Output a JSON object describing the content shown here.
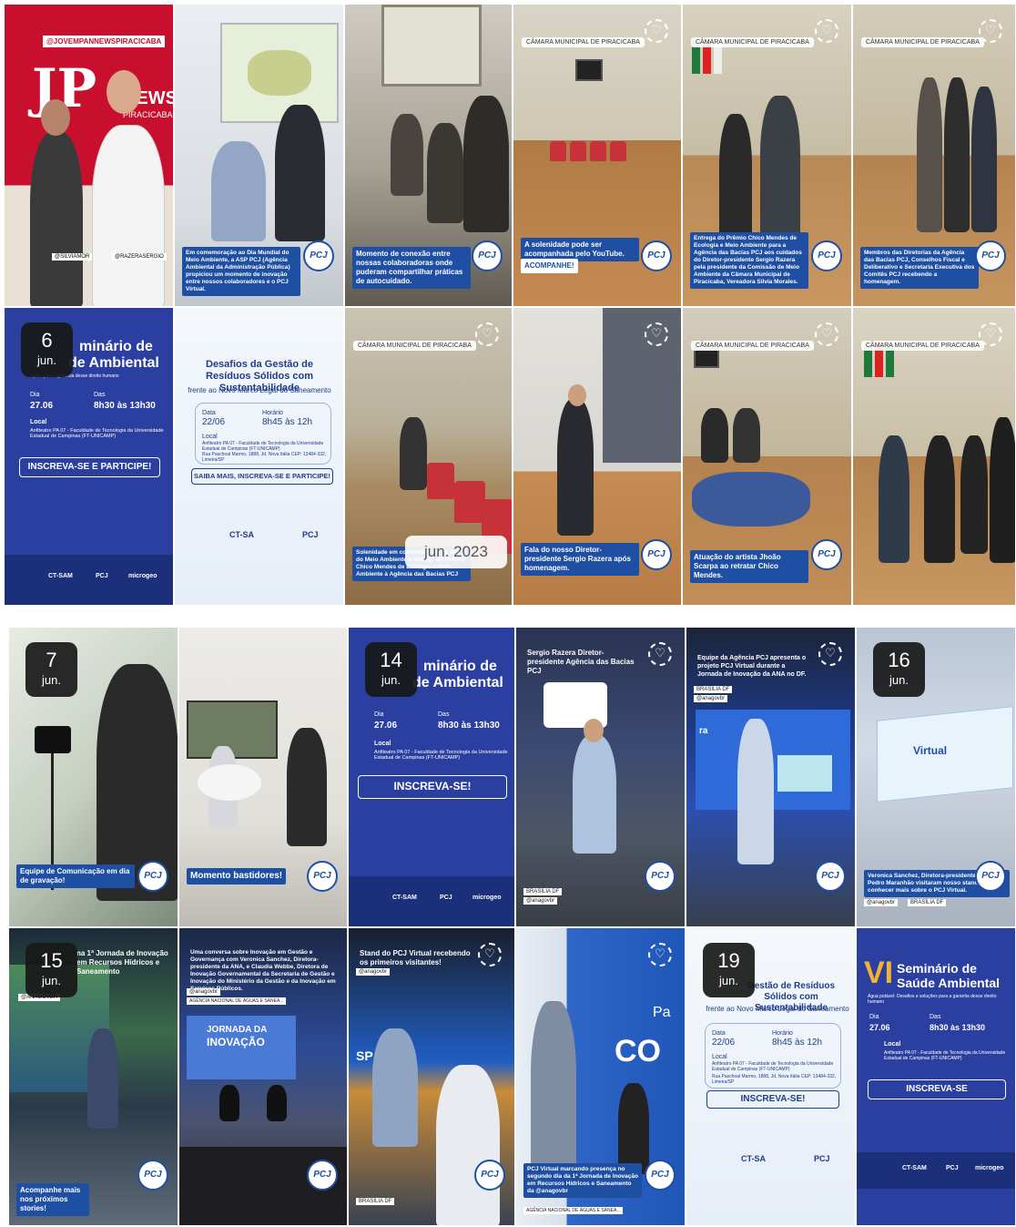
{
  "stories": {
    "t1": {
      "top_tag": "@JOVEMPANNEWSPIRACICABA",
      "brand": "JP",
      "city": "PIRACICABA",
      "tag_left": "@SILVIAMOR",
      "tag_right": "@RAZERASERGIO"
    },
    "t2": {
      "caption": "Em comemoração ao Dia Mundial do Meio Ambiente, a ASP PCJ (Agência Ambiental da Administração Pública) propiciou um momento de inovação entre nossos colaboradores e o PCJ Virtual."
    },
    "t3": {
      "caption": "Momento de conexão entre nossas colaboradoras onde puderam compartilhar práticas de autocuidado."
    },
    "t4": {
      "location": "CÂMARA MUNICIPAL DE PIRACICABA",
      "caption": "A solenidade pode ser acompanhada pelo YouTube.",
      "link": "ACOMPANHE!"
    },
    "t5": {
      "location": "CÂMARA MUNICIPAL DE PIRACICABA",
      "caption": "Entrega do Prêmio Chico Mendes de Ecologia e Meio Ambiente para a Agência das Bacias PCJ aos cuidados do Diretor-presidente Sergio Razera pela presidente da Comissão de Meio Ambiente da Câmara Municipal de Piracicaba, Vereadora Silvia Morales."
    },
    "t6": {
      "location": "CÂMARA MUNICIPAL DE PIRACICABA",
      "caption": "Membros das Diretorias da Agência das Bacias PCJ, Conselhos Fiscal e Deliberativo e Secretaria Executiva dos Comitês PCJ recebendo a homenagem."
    },
    "t7": {
      "date_day": "6",
      "date_month": "jun.",
      "title_a": "minário de",
      "title_b": "de Ambiental",
      "subtitle": "ações para a garantia desse direito humano",
      "dia_label": "Dia",
      "dia": "27.06",
      "horas_label": "Das",
      "horas": "8h30 às 13h30",
      "local_label": "Local",
      "local": "Anfiteatro PA 07 - Faculdade de Tecnologia da Universidade Estadual de Campinas (FT-UNICAMP)",
      "button": "INSCREVA-SE E PARTICIPE!",
      "f1": "CT-SAM",
      "f2": "PCJ",
      "f3": "microgeo"
    },
    "t8": {
      "title": "Desafios da Gestão de Resíduos Sólidos com Sustentabilidade",
      "subtitle": "frente ao Novo Marco Legal do Saneamento",
      "data_label": "Data",
      "data": "22/06",
      "hora_label": "Horário",
      "hora": "8h45 às 12h",
      "local_label": "Local",
      "local": "Anfiteatro PA 07 - Faculdade de Tecnologia da Universidade Estadual de Campinas (FT-UNICAMP)",
      "addr": "Rua Paschoal Marmo, 1888, Jd. Nova Itália CEP: 13484-332, Limeira/SP",
      "button": "SAIBA MAIS, INSCREVA-SE E PARTICIPE!",
      "f1": "CT-SA",
      "f2": "PCJ"
    },
    "t9": {
      "location": "CÂMARA MUNICIPAL DE PIRACICABA",
      "caption": "Solenidade em comemoração ao Dia do Meio Ambiente e entrega do Prêmio Chico Mendes de Ecologia e Meio Ambiente à Agência das Bacias PCJ",
      "overlay": "jun. 2023"
    },
    "t10": {
      "caption": "Fala do nosso Diretor-presidente Sergio Razera após homenagem."
    },
    "t11": {
      "location": "CÂMARA MUNICIPAL DE PIRACICABA",
      "caption": "Atuação do artista Jhoão Scarpa ao retratar Chico Mendes."
    },
    "t12": {
      "location": "CÂMARA MUNICIPAL DE PIRACICABA"
    },
    "t13": {
      "date_day": "7",
      "date_month": "jun.",
      "caption": "Equipe de Comunicação em dia de gravação!"
    },
    "t14": {
      "caption": "Momento bastidores!"
    },
    "t15": {
      "date_day": "14",
      "date_month": "jun.",
      "title_a": "minário de",
      "title_b": "de Ambiental",
      "dia_label": "Dia",
      "dia": "27.06",
      "horas_label": "Das",
      "horas": "8h30 às 13h30",
      "local_label": "Local",
      "local": "Anfiteatro PA 07 - Faculdade de Tecnologia da Universidade Estadual de Campinas (FT-UNICAMP)",
      "button": "INSCREVA-SE!",
      "f1": "CT-SAM",
      "f2": "PCJ",
      "f3": "microgeo"
    },
    "t16": {
      "caption": "Sergio Razera Diretor-presidente Agência das Bacias PCJ",
      "tag1": "BRASÍLIA DF",
      "tag2": "@anagovbr"
    },
    "t17": {
      "caption": "Equipe da Agência PCJ apresenta o projeto PCJ Virtual durante a Jornada de Inovação da ANA no DF.",
      "tag1": "BRASÍLIA DF",
      "tag2": "@anagovbr",
      "screen_text": "ra"
    },
    "t18": {
      "date_day": "16",
      "date_month": "jun.",
      "box_label": "Virtual",
      "caption": "Veronica Sanchez, Diretora-presidente da ANA e Pedro Maranhão visitaram nosso stand para conhecer mais sobre o PCJ Virtual.",
      "tag1": "@anagovbr",
      "tag2": "BRASÍLIA DF"
    },
    "t19": {
      "date_day": "15",
      "date_month": "jun.",
      "caption_top": "na 1ª Jornada de Inovação em Recursos Hídricos e Saneamento",
      "tag": "@ANAGOVBR",
      "caption": "Acompanhe mais nos próximos stories!"
    },
    "t20": {
      "caption": "Uma conversa sobre Inovação em Gestão e Governança com Veronica Sanchez, Diretora-presidente da ANA, e Claudia Webbe, Diretora de Inovação Governamental da Secretaria de Gestão e Inovação do Ministério da Gestão e da Inovação em Serviços Públicos.",
      "tag": "@anagovbr",
      "tag2": "AGÊNCIA NACIONAL DE ÁGUAS E SANEA...",
      "screen_a": "JORNADA DA",
      "screen_b": "INOVAÇÃO"
    },
    "t21": {
      "caption": "Stand do PCJ Virtual recebendo os primeiros visitantes!",
      "tag": "@anagovbr",
      "tag2": "BRASÍLIA DF",
      "wall": "SP"
    },
    "t22": {
      "wall_a": "Pa",
      "wall_b": "CO",
      "caption": "PCJ Virtual marcando presença no segundo dia da 1ª Jornada de Inovação em Recursos Hídricos e Saneamento da @anagovbr",
      "tag": "AGÊNCIA NACIONAL DE ÁGUAS E SANEA..."
    },
    "t23": {
      "date_day": "19",
      "date_month": "jun.",
      "title": "Gestão de Resíduos Sólidos com Sustentabilidade",
      "subtitle": "frente ao Novo Marco Legal do Saneamento",
      "data_label": "Data",
      "data": "22/06",
      "hora_label": "Horário",
      "hora": "8h45 às 12h",
      "local_label": "Local",
      "local": "Anfiteatro PA 07 - Faculdade de Tecnologia da Universidade Estadual de Campinas (FT-UNICAMP)",
      "addr": "Rua Paschoal Marmo, 1888, Jd. Nova Itália CEP: 13484-332, Limeira/SP",
      "button": "INSCREVA-SE!",
      "f1": "CT-SA",
      "f2": "PCJ"
    },
    "t24": {
      "title_vi": "VI",
      "title_a": "Seminário de",
      "title_b": "Saúde Ambiental",
      "subtitle": "Água potável: Desafios e soluções para a garantia desse direito humano",
      "dia_label": "Dia",
      "dia": "27.06",
      "horas_label": "Das",
      "horas": "8h30 às 13h30",
      "local_label": "Local",
      "local": "Anfiteatro PA 07 - Faculdade de Tecnologia da Universidade Estadual de Campinas (FT-UNICAMP)",
      "button": "INSCREVA-SE",
      "f1": "CT-SAM",
      "f2": "PCJ",
      "f3": "microgeo"
    }
  },
  "logo_text": "PCJ",
  "heart_icon": "♡",
  "colors": {
    "pcj_blue": "#1f4fa3",
    "poster_blue": "#22399a",
    "jp_red": "#c8102e",
    "seat_red": "#c7323a"
  }
}
